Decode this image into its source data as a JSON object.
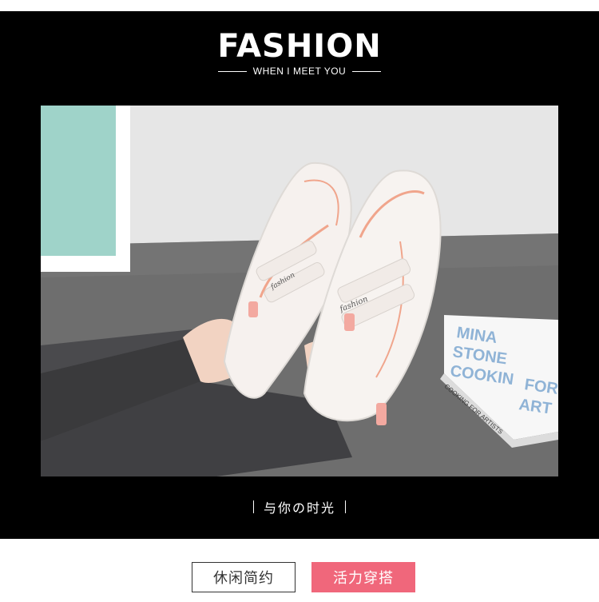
{
  "banner": {
    "title": "FASHION",
    "subtitle": "WHEN I MEET YOU",
    "background": "#000000"
  },
  "photo": {
    "book_lines": [
      "MINA",
      "STONE",
      "COOKIN",
      "FOR",
      "ART"
    ],
    "book_spine": "COOKING FOR ARTISTS",
    "shoe_script": "fashion"
  },
  "tagline": {
    "text": "与你の时光"
  },
  "tags": {
    "left_label": "休闲简约",
    "right_label": "活力穿搭",
    "accent": "#f0677b"
  }
}
